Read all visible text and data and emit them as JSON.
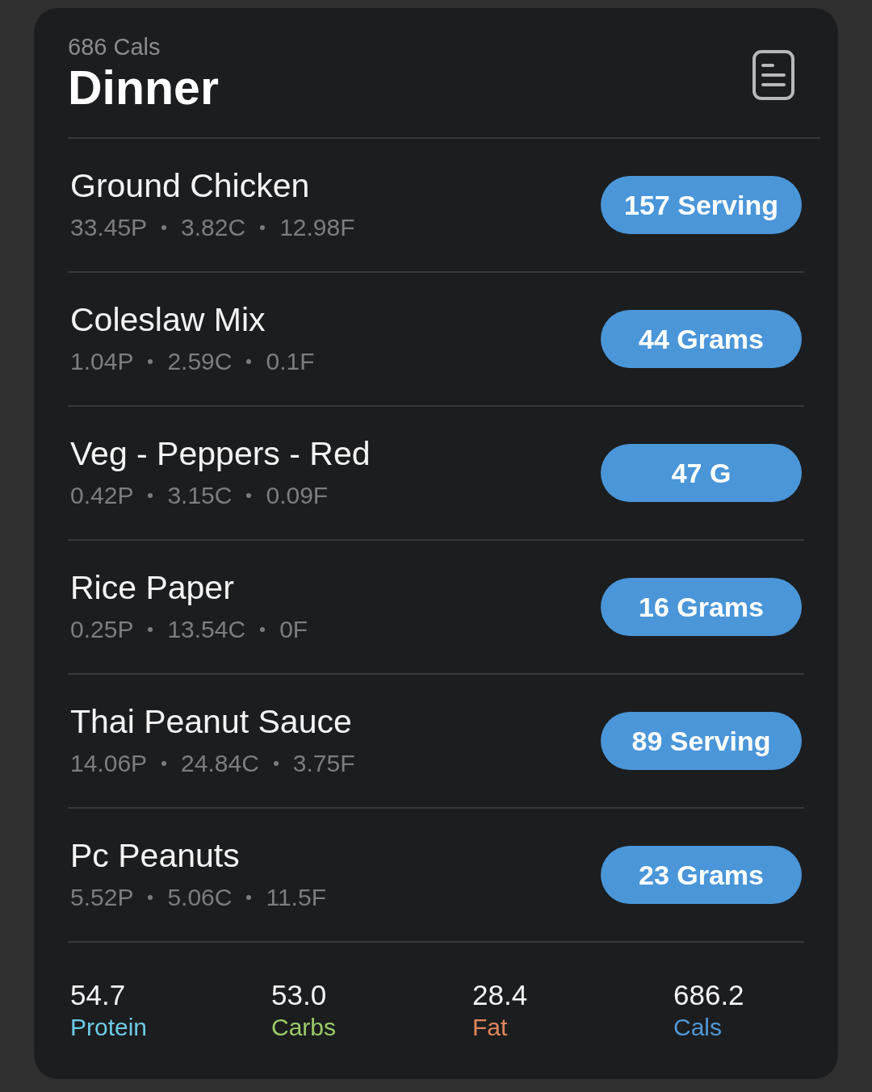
{
  "header": {
    "subtitle": "686 Cals",
    "title": "Dinner"
  },
  "foods": [
    {
      "name": "Ground Chicken",
      "macros": [
        "33.45P",
        "3.82C",
        "12.98F"
      ],
      "amount": "157 Serving"
    },
    {
      "name": "Coleslaw Mix",
      "macros": [
        "1.04P",
        "2.59C",
        "0.1F"
      ],
      "amount": "44 Grams"
    },
    {
      "name": "Veg - Peppers - Red",
      "macros": [
        "0.42P",
        "3.15C",
        "0.09F"
      ],
      "amount": "47 G"
    },
    {
      "name": "Rice Paper",
      "macros": [
        "0.25P",
        "13.54C",
        "0F"
      ],
      "amount": "16 Grams"
    },
    {
      "name": "Thai Peanut Sauce",
      "macros": [
        "14.06P",
        "24.84C",
        "3.75F"
      ],
      "amount": "89 Serving"
    },
    {
      "name": "Pc Peanuts",
      "macros": [
        "5.52P",
        "5.06C",
        "11.5F"
      ],
      "amount": "23 Grams"
    }
  ],
  "totals": [
    {
      "value": "54.7",
      "label": "Protein",
      "color": "#6ccbe6"
    },
    {
      "value": "53.0",
      "label": "Carbs",
      "color": "#9acb68"
    },
    {
      "value": "28.4",
      "label": "Fat",
      "color": "#e2875a"
    },
    {
      "value": "686.2",
      "label": "Cals",
      "color": "#4f98d6"
    }
  ]
}
